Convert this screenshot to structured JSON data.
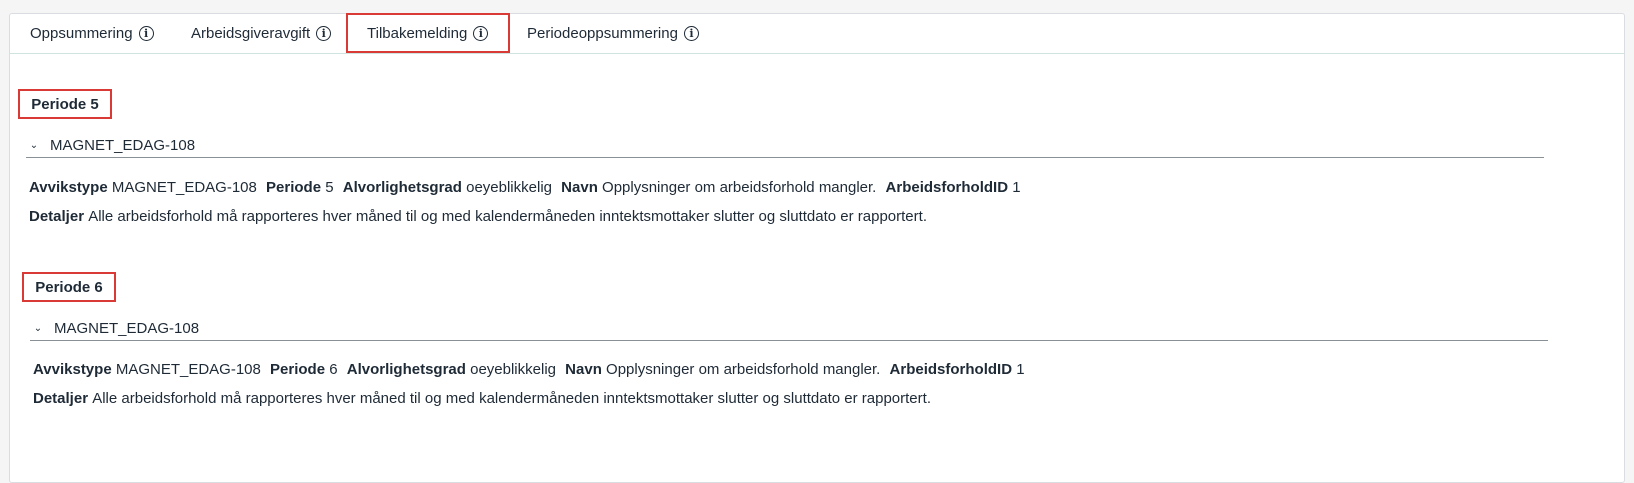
{
  "tabs": [
    {
      "label": "Oppsummering"
    },
    {
      "label": "Arbeidsgiveravgift"
    },
    {
      "label": "Tilbakemelding"
    },
    {
      "label": "Periodeoppsummering"
    }
  ],
  "info_glyph": "i",
  "active_tab": "Tilbakemelding",
  "highlight_color": "#d93a35",
  "sections": [
    {
      "title": "Periode 5",
      "accordion_label": "MAGNET_EDAG-108",
      "fields": {
        "avvikstype_label": "Avvikstype",
        "avvikstype_value": "MAGNET_EDAG-108",
        "periode_label": "Periode",
        "periode_value": "5",
        "alvorlighetsgrad_label": "Alvorlighetsgrad",
        "alvorlighetsgrad_value": "oeyeblikkelig",
        "navn_label": "Navn",
        "navn_value": "Opplysninger om arbeidsforhold mangler.",
        "arbeidsforholdid_label": "ArbeidsforholdID",
        "arbeidsforholdid_value": "1",
        "detaljer_label": "Detaljer",
        "detaljer_value": "Alle arbeidsforhold må rapporteres hver måned til og med kalendermåneden inntektsmottaker slutter og sluttdato er rapportert."
      }
    },
    {
      "title": "Periode 6",
      "accordion_label": "MAGNET_EDAG-108",
      "fields": {
        "avvikstype_label": "Avvikstype",
        "avvikstype_value": "MAGNET_EDAG-108",
        "periode_label": "Periode",
        "periode_value": "6",
        "alvorlighetsgrad_label": "Alvorlighetsgrad",
        "alvorlighetsgrad_value": "oeyeblikkelig",
        "navn_label": "Navn",
        "navn_value": "Opplysninger om arbeidsforhold mangler.",
        "arbeidsforholdid_label": "ArbeidsforholdID",
        "arbeidsforholdid_value": "1",
        "detaljer_label": "Detaljer",
        "detaljer_value": "Alle arbeidsforhold må rapporteres hver måned til og med kalendermåneden inntektsmottaker slutter og sluttdato er rapportert."
      }
    }
  ]
}
